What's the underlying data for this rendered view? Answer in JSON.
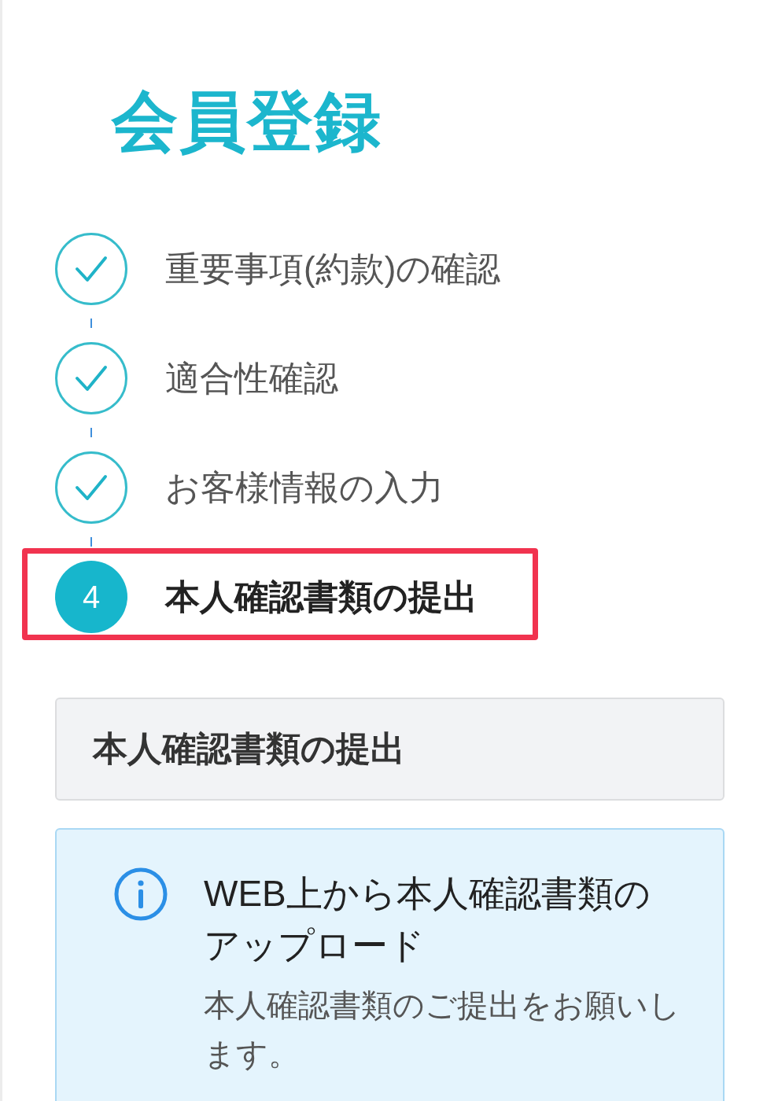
{
  "page_title": "会員登録",
  "steps": [
    {
      "label": "重要事項(約款)の確認",
      "kind": "done",
      "highlighted": false
    },
    {
      "label": "適合性確認",
      "kind": "done",
      "highlighted": false
    },
    {
      "label": "お客様情報の入力",
      "kind": "done",
      "highlighted": false
    },
    {
      "label": "本人確認書類の提出",
      "number": "4",
      "kind": "current",
      "highlighted": true
    }
  ],
  "section_header": "本人確認書類の提出",
  "info_box": {
    "title": "WEB上から本人確認書類のアップロード",
    "body": "本人確認書類のご提出をお願いします。"
  }
}
